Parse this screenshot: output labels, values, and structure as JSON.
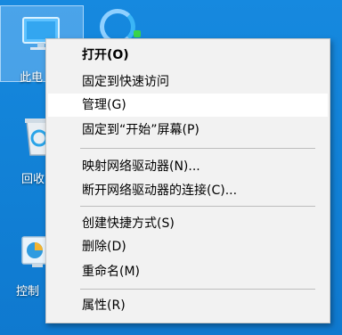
{
  "desktop": {
    "icons": [
      {
        "label": "此电",
        "icon": "computer-icon"
      },
      {
        "label": "回收",
        "icon": "recycle-bin-icon"
      },
      {
        "label": "控制",
        "icon": "control-panel-icon"
      }
    ]
  },
  "context_menu": {
    "items": [
      {
        "label": "打开(O)",
        "bold": true
      },
      {
        "label": "固定到快速访问"
      },
      {
        "label": "管理(G)",
        "highlighted": true
      },
      {
        "label": "固定到“开始”屏幕(P)"
      },
      {
        "label": "映射网络驱动器(N)..."
      },
      {
        "label": "断开网络驱动器的连接(C)..."
      },
      {
        "label": "创建快捷方式(S)"
      },
      {
        "label": "删除(D)"
      },
      {
        "label": "重命名(M)"
      },
      {
        "label": "属性(R)"
      }
    ]
  },
  "colors": {
    "desktop": "#1282d7",
    "menu_bg": "#f2f2f2",
    "highlight": "#ffffff"
  }
}
